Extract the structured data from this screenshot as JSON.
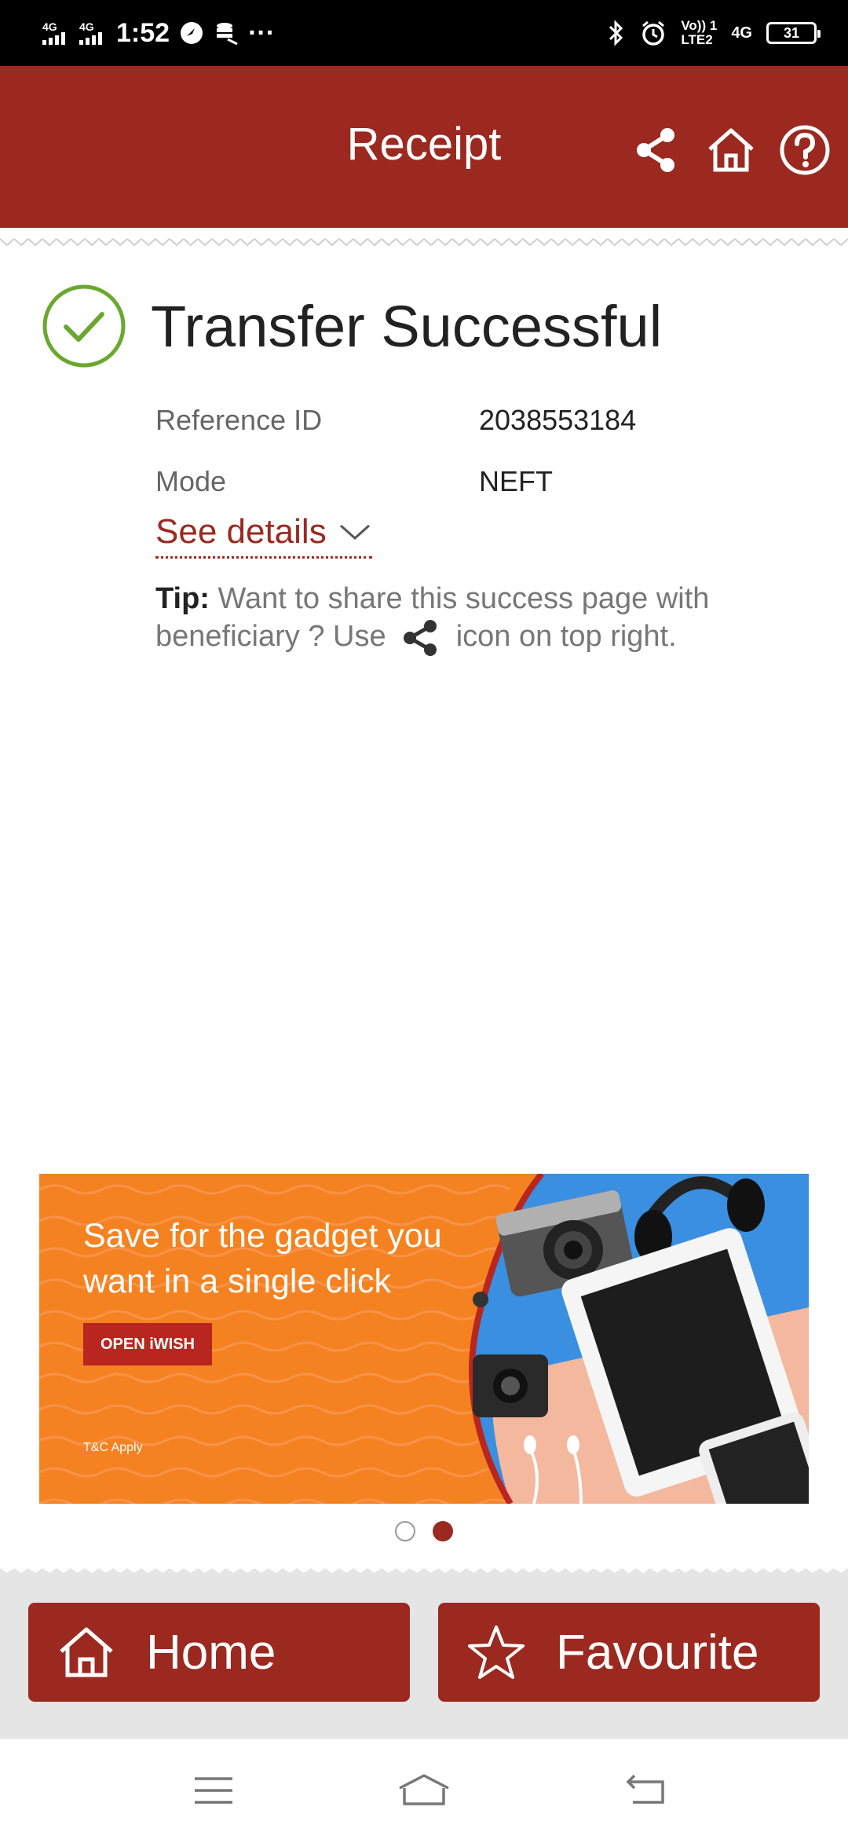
{
  "status_bar": {
    "network1": "4G",
    "network2": "4G",
    "time": "1:52",
    "more": "···",
    "volte": "Vo)) 1",
    "lte": "LTE2",
    "network3": "4G",
    "battery": "31"
  },
  "header": {
    "title": "Receipt",
    "icons": [
      "share-icon",
      "home-icon",
      "help-icon"
    ]
  },
  "result": {
    "title": "Transfer Successful",
    "reference_label": "Reference ID",
    "reference_value": "2038553184",
    "mode_label": "Mode",
    "mode_value": "NEFT",
    "see_details": "See details"
  },
  "tip": {
    "label": "Tip:",
    "text_before": "Want to share this success page with beneficiary ? Use",
    "text_after": "icon on top right."
  },
  "banner": {
    "text": "Save for the gadget you want in a single click",
    "button": "OPEN iWISH",
    "terms": "T&C Apply"
  },
  "carousel": {
    "count": 2,
    "active": 2
  },
  "actions": {
    "home": "Home",
    "favourite": "Favourite"
  },
  "colors": {
    "brand": "#9b2920",
    "success": "#6aa82f",
    "banner_orange": "#f58220"
  }
}
